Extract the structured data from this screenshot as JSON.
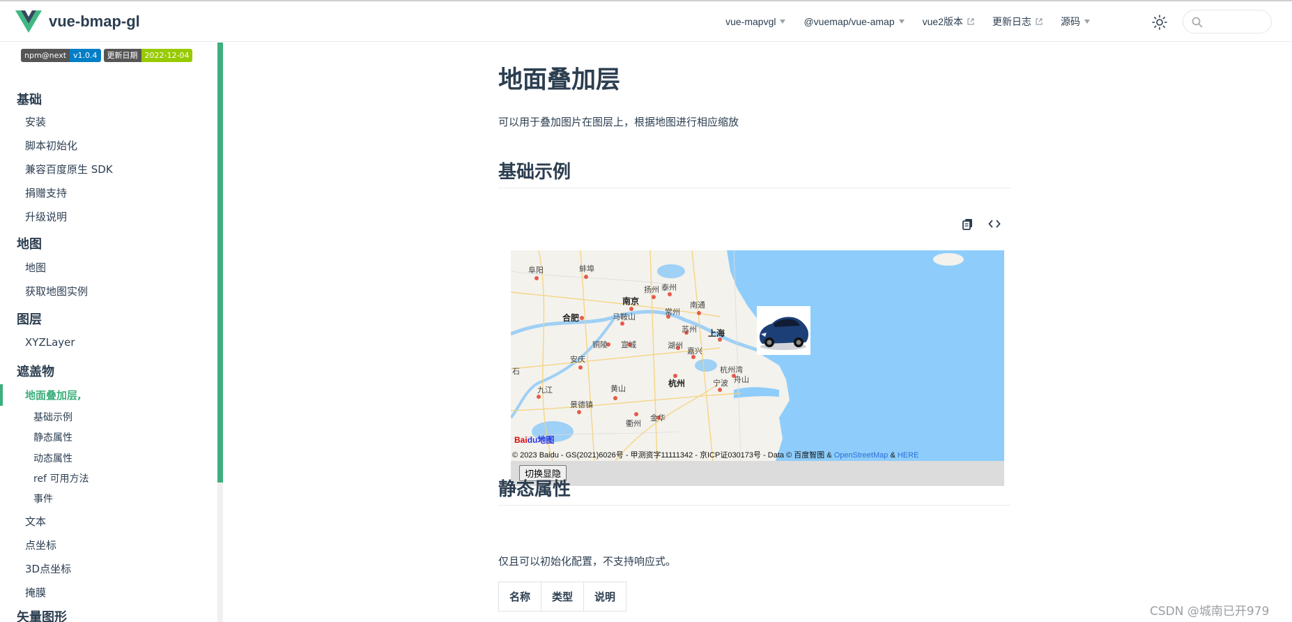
{
  "app": {
    "title": "vue-bmap-gl",
    "brand_color": "#3eaf7c",
    "logo_icon": "vue-logo-icon"
  },
  "navbar": {
    "items": [
      {
        "label": "vue-mapvgl",
        "type": "dropdown"
      },
      {
        "label": "@vuemap/vue-amap",
        "type": "dropdown"
      },
      {
        "label": "vue2版本",
        "type": "external"
      },
      {
        "label": "更新日志",
        "type": "external"
      },
      {
        "label": "源码",
        "type": "dropdown"
      }
    ],
    "theme_icon": "sun-icon",
    "search": {
      "placeholder": "",
      "value": "",
      "icon": "search-icon"
    }
  },
  "badges": [
    {
      "key": "npm@next",
      "value": "v1.0.4",
      "color": "#007ec6"
    },
    {
      "key": "更新日期",
      "value": "2022-12-04",
      "color": "#97ca00"
    }
  ],
  "sidebar": {
    "groups": [
      {
        "title": "基础",
        "items": [
          "安装",
          "脚本初始化",
          "兼容百度原生 SDK",
          "捐赠支持",
          "升级说明"
        ]
      },
      {
        "title": "地图",
        "items": [
          "地图",
          "获取地图实例"
        ]
      },
      {
        "title": "图层",
        "items": [
          "XYZLayer"
        ]
      },
      {
        "title": "遮盖物",
        "items": [
          "地面叠加层,",
          "文本",
          "点坐标",
          "3D点坐标",
          "掩膜"
        ]
      },
      {
        "title": "矢量图形",
        "items": []
      }
    ],
    "active_item": "地面叠加层,",
    "active_subitems": [
      "基础示例",
      "静态属性",
      "动态属性",
      "ref 可用方法",
      "事件"
    ]
  },
  "content": {
    "title": "地面叠加层",
    "description": "可以用于叠加图片在图层上，根据地图进行相应缩放",
    "sections": {
      "basic_example": "基础示例",
      "static_props": "静态属性"
    },
    "demo_tools": {
      "copy_icon": "copy-icon",
      "code_icon": "code-icon"
    },
    "map": {
      "labels": [
        "阜阳",
        "蚌埠",
        "扬州",
        "泰州",
        "南京",
        "合肥",
        "马鞍山",
        "常州",
        "南通",
        "上海",
        "苏州",
        "铜陵",
        "宣城",
        "湖州",
        "嘉兴",
        "安庆",
        "杭州湾",
        "舟山",
        "杭州",
        "宁波",
        "九江",
        "黄山",
        "景德镇",
        "衢州",
        "金华",
        "石"
      ],
      "copyright_prefix": "© 2023 Baidu - GS(2021)6026号 - 甲测资字11111342 - 京ICP证030173号 - Data © 百度智图 &",
      "copyright_osm": "OpenStreetMap",
      "copyright_amp": "&",
      "copyright_here": "HERE",
      "baidu_logo_red": "Bai",
      "baidu_logo_blue": "du地图",
      "toggle_button": "切换显隐"
    },
    "static_desc": "仅且可以初始化配置，不支持响应式。",
    "table_headers": [
      "名称",
      "类型",
      "说明"
    ]
  },
  "watermark": "CSDN @城南已开979"
}
